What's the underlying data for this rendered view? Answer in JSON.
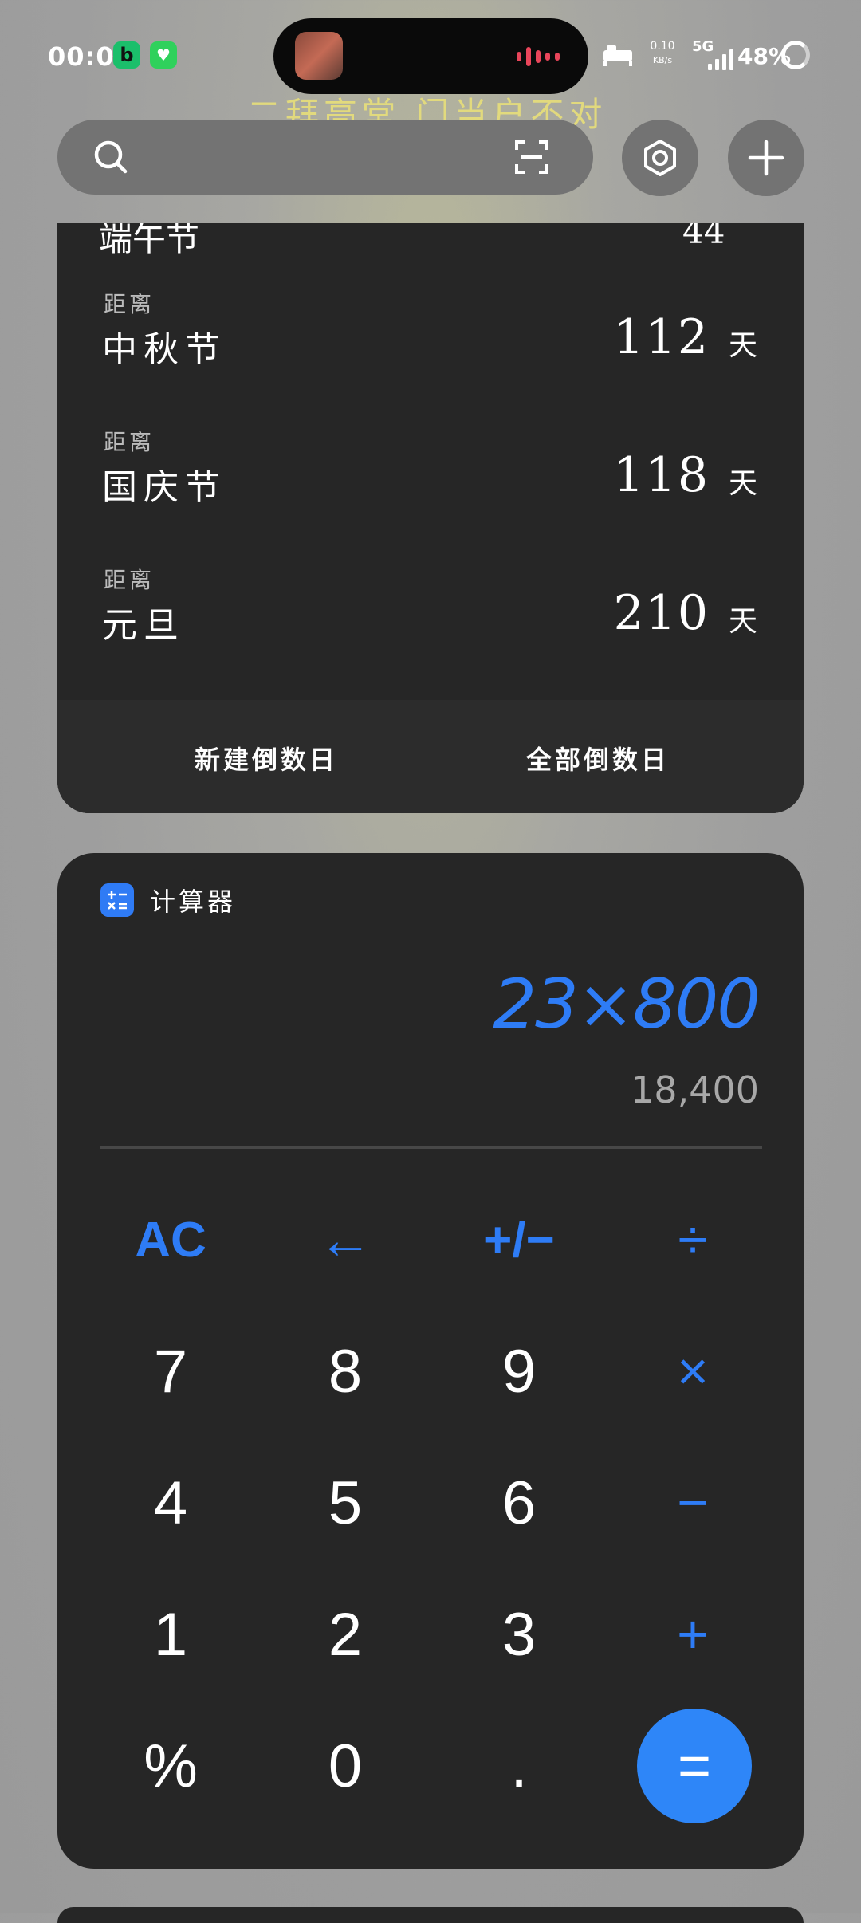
{
  "status_bar": {
    "time": "00:05",
    "app1_glyph": "b",
    "net_speed_value": "0.10",
    "net_speed_unit": "KB/s",
    "network": "5G",
    "battery": "48%"
  },
  "watermark": "二拜高堂 门当户不对",
  "countdown": {
    "items": [
      {
        "label": "距离",
        "name": "中秋节",
        "days": "112",
        "unit": "天"
      },
      {
        "label": "距离",
        "name": "国庆节",
        "days": "118",
        "unit": "天"
      },
      {
        "label": "距离",
        "name": "元旦",
        "days": "210",
        "unit": "天"
      }
    ],
    "new_label": "新建倒数日",
    "all_label": "全部倒数日"
  },
  "calculator": {
    "title": "计算器",
    "expression": "23×800",
    "result": "18,400",
    "keys": {
      "ac": "AC",
      "back": "←",
      "sign": "+/−",
      "div": "÷",
      "k7": "7",
      "k8": "8",
      "k9": "9",
      "mul": "×",
      "k4": "4",
      "k5": "5",
      "k6": "6",
      "sub": "−",
      "k1": "1",
      "k2": "2",
      "k3": "3",
      "add": "+",
      "pct": "%",
      "k0": "0",
      "dot": ".",
      "eq": "="
    }
  },
  "colors": {
    "accent": "#2e7cf6",
    "card": "#262626",
    "watermark": "#e8df7a"
  }
}
